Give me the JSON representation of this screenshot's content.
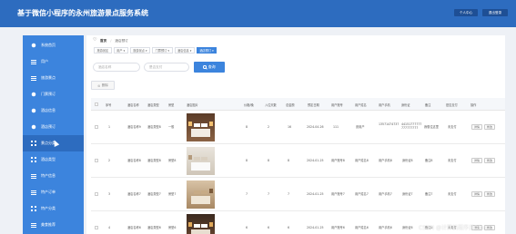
{
  "header": {
    "title": "基于微信小程序的永州旅游景点服务系统",
    "personal_center": "个人中心",
    "logout": "退出登录"
  },
  "sidebar": {
    "items": [
      {
        "label": "系统首页",
        "icon": "home-icon"
      },
      {
        "label": "用户",
        "icon": "user-icon"
      },
      {
        "label": "旅游景点",
        "icon": "scenic-icon"
      },
      {
        "label": "门票预订",
        "icon": "ticket-icon"
      },
      {
        "label": "酒店信息",
        "icon": "hotel-icon"
      },
      {
        "label": "酒店预订",
        "icon": "booking-icon"
      },
      {
        "label": "景点分类",
        "icon": "category-icon"
      },
      {
        "label": "酒店类型",
        "icon": "type-icon"
      },
      {
        "label": "特产信息",
        "icon": "specialty-icon"
      },
      {
        "label": "特产订单",
        "icon": "order-icon"
      },
      {
        "label": "特产分类",
        "icon": "specialty-category-icon"
      },
      {
        "label": "美食推荐",
        "icon": "food-icon"
      }
    ],
    "active_index": 5
  },
  "breadcrumb": {
    "home": "首页",
    "current": "酒店预订"
  },
  "tabs": [
    "旅游景区",
    "用户 ▾",
    "旅游景点 ▾",
    "门票预订 ▾",
    "酒店信息 ▾",
    "酒店预订 ▾"
  ],
  "search": {
    "hotel_name_placeholder": "酒店名称",
    "status_placeholder": "是否支付",
    "search_button": "查询"
  },
  "delete_button": "删除",
  "table": {
    "columns": [
      "序号",
      "酒店名称",
      "酒店类型",
      "房型",
      "酒店图片",
      "价格/晚",
      "入住天数",
      "总金额",
      "预定日期",
      "用户账号",
      "用户姓名",
      "用户手机",
      "身份证",
      "备注",
      "是否支付",
      "操作"
    ],
    "rows": [
      {
        "index": "1",
        "hotel_name": "酒店名称9",
        "hotel_type": "酒店类型8",
        "room_type": "一般",
        "price": "8",
        "days": "2",
        "total": "16",
        "date": "2024-04-26",
        "account": "111",
        "user_name": "张用户",
        "phone": "13571474737",
        "id_card": "44151777777777777777",
        "remark": "我想住这里",
        "paid": "未支付"
      },
      {
        "index": "2",
        "hotel_name": "酒店名称8",
        "hotel_type": "酒店类型8",
        "room_type": "房型8",
        "price": "8",
        "days": "8",
        "total": "8",
        "date": "2024-01-25",
        "account": "用户账号8",
        "user_name": "用户姓名8",
        "phone": "用户手机8",
        "id_card": "身份证8",
        "remark": "备注8",
        "paid": "未支付"
      },
      {
        "index": "3",
        "hotel_name": "酒店名称7",
        "hotel_type": "酒店类型7",
        "room_type": "房型7",
        "price": "7",
        "days": "7",
        "total": "7",
        "date": "2024-01-25",
        "account": "用户账号7",
        "user_name": "用户姓名7",
        "phone": "用户手机7",
        "id_card": "身份证7",
        "remark": "备注7",
        "paid": "未支付"
      },
      {
        "index": "4",
        "hotel_name": "酒店名称6",
        "hotel_type": "酒店类型6",
        "room_type": "房型6",
        "price": "6",
        "days": "6",
        "total": "6",
        "date": "2024-01-25",
        "account": "用户账号6",
        "user_name": "用户姓名6",
        "phone": "用户手机6",
        "id_card": "身份证6",
        "remark": "备注6",
        "paid": "未支付"
      }
    ],
    "row_actions": {
      "detail": "详情",
      "edit": "修改"
    }
  },
  "watermark": "CSDN @计算机程序员Dion"
}
